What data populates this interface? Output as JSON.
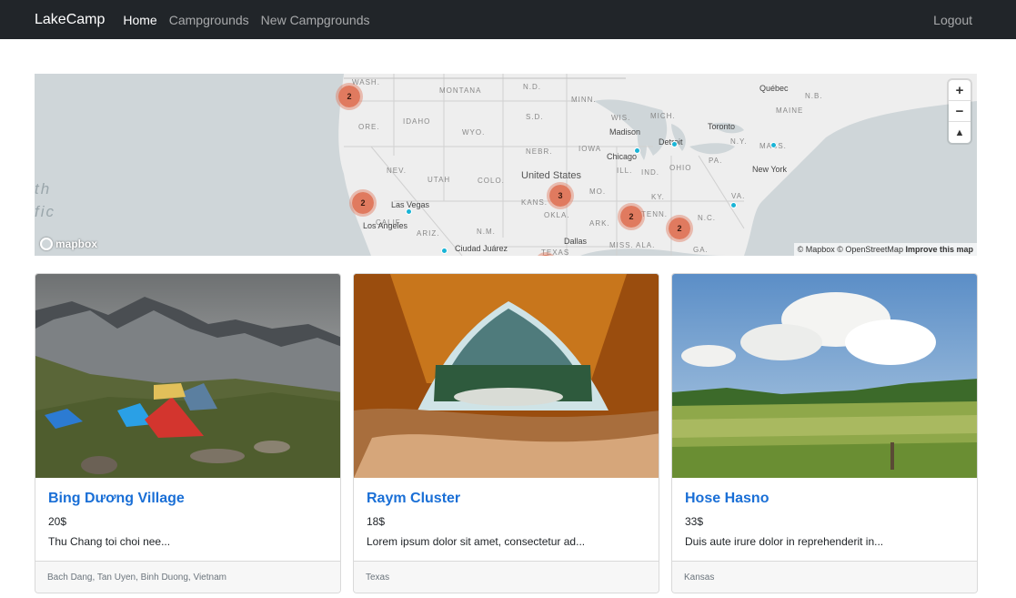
{
  "nav": {
    "brand": "LakeCamp",
    "links": [
      "Home",
      "Campgrounds",
      "New Campgrounds"
    ],
    "logout": "Logout"
  },
  "map": {
    "state_labels": [
      "WASH.",
      "MONTANA",
      "N.D.",
      "MINN.",
      "ORE.",
      "IDAHO",
      "WYO.",
      "S.D.",
      "WIS.",
      "MICH.",
      "MAINE",
      "N.B.",
      "NEBR.",
      "IOWA",
      "NEV.",
      "UTAH",
      "COLO.",
      "ILL.",
      "IND.",
      "OHIO",
      "PA.",
      "N.Y.",
      "MASS.",
      "KANS.",
      "MO.",
      "KY.",
      "VA.",
      "CALIF.",
      "ARIZ.",
      "N.M.",
      "OKLA.",
      "ARK.",
      "TENN.",
      "N.C.",
      "MISS.",
      "ALA.",
      "GA.",
      "TEXAS"
    ],
    "city_labels": [
      "Québec",
      "Toronto",
      "Madison",
      "Detroit",
      "Chicago",
      "New York",
      "United States",
      "Las Vegas",
      "Los Angeles",
      "Dallas",
      "Ciudad Juárez"
    ],
    "sea_label": [
      "th",
      "fic"
    ],
    "clusters": [
      "2",
      "2",
      "3",
      "2",
      "2"
    ],
    "controls": [
      "+",
      "−",
      "▲"
    ],
    "logo": "mapbox",
    "attribution": "© Mapbox © OpenStreetMap",
    "improve": "Improve this map"
  },
  "cards": [
    {
      "title": "Bing Dương Village",
      "price": "20$",
      "description": "Thu Chang toi choi nee...",
      "location": "Bach Dang, Tan Uyen, Binh Duong, Vietnam"
    },
    {
      "title": "Raym Cluster",
      "price": "18$",
      "description": "Lorem ipsum dolor sit amet, consectetur ad...",
      "location": "Texas"
    },
    {
      "title": "Hose Hasno",
      "price": "33$",
      "description": "Duis aute irure dolor in reprehenderit in...",
      "location": "Kansas"
    }
  ]
}
